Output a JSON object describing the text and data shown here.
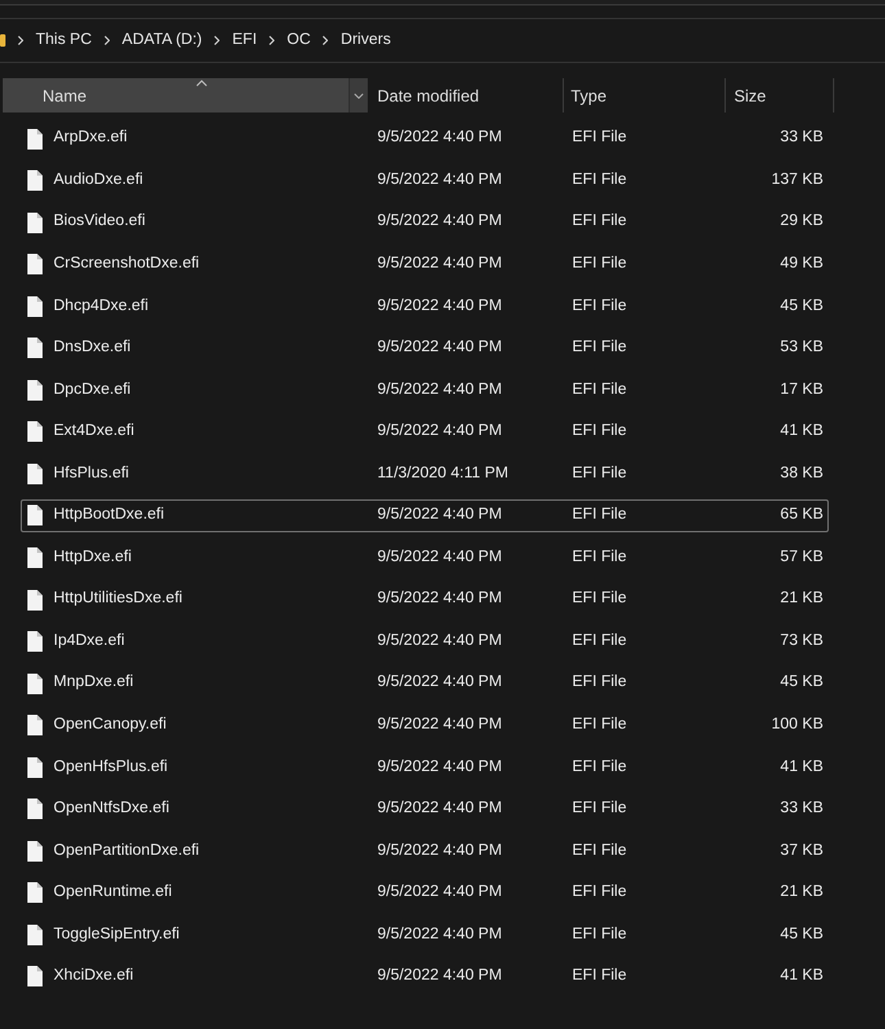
{
  "breadcrumbs": [
    "This PC",
    "ADATA (D:)",
    "EFI",
    "OC",
    "Drivers"
  ],
  "columns": [
    {
      "label": "Name",
      "sorted": true,
      "hovered": true
    },
    {
      "label": "Date modified",
      "sorted": false,
      "hovered": false
    },
    {
      "label": "Type",
      "sorted": false,
      "hovered": false
    },
    {
      "label": "Size",
      "sorted": false,
      "hovered": false
    }
  ],
  "files": [
    {
      "name": "ArpDxe.efi",
      "date_modified": "9/5/2022 4:40 PM",
      "type": "EFI File",
      "size": "33 KB",
      "focused": false
    },
    {
      "name": "AudioDxe.efi",
      "date_modified": "9/5/2022 4:40 PM",
      "type": "EFI File",
      "size": "137 KB",
      "focused": false
    },
    {
      "name": "BiosVideo.efi",
      "date_modified": "9/5/2022 4:40 PM",
      "type": "EFI File",
      "size": "29 KB",
      "focused": false
    },
    {
      "name": "CrScreenshotDxe.efi",
      "date_modified": "9/5/2022 4:40 PM",
      "type": "EFI File",
      "size": "49 KB",
      "focused": false
    },
    {
      "name": "Dhcp4Dxe.efi",
      "date_modified": "9/5/2022 4:40 PM",
      "type": "EFI File",
      "size": "45 KB",
      "focused": false
    },
    {
      "name": "DnsDxe.efi",
      "date_modified": "9/5/2022 4:40 PM",
      "type": "EFI File",
      "size": "53 KB",
      "focused": false
    },
    {
      "name": "DpcDxe.efi",
      "date_modified": "9/5/2022 4:40 PM",
      "type": "EFI File",
      "size": "17 KB",
      "focused": false
    },
    {
      "name": "Ext4Dxe.efi",
      "date_modified": "9/5/2022 4:40 PM",
      "type": "EFI File",
      "size": "41 KB",
      "focused": false
    },
    {
      "name": "HfsPlus.efi",
      "date_modified": "11/3/2020 4:11 PM",
      "type": "EFI File",
      "size": "38 KB",
      "focused": false
    },
    {
      "name": "HttpBootDxe.efi",
      "date_modified": "9/5/2022 4:40 PM",
      "type": "EFI File",
      "size": "65 KB",
      "focused": true
    },
    {
      "name": "HttpDxe.efi",
      "date_modified": "9/5/2022 4:40 PM",
      "type": "EFI File",
      "size": "57 KB",
      "focused": false
    },
    {
      "name": "HttpUtilitiesDxe.efi",
      "date_modified": "9/5/2022 4:40 PM",
      "type": "EFI File",
      "size": "21 KB",
      "focused": false
    },
    {
      "name": "Ip4Dxe.efi",
      "date_modified": "9/5/2022 4:40 PM",
      "type": "EFI File",
      "size": "73 KB",
      "focused": false
    },
    {
      "name": "MnpDxe.efi",
      "date_modified": "9/5/2022 4:40 PM",
      "type": "EFI File",
      "size": "45 KB",
      "focused": false
    },
    {
      "name": "OpenCanopy.efi",
      "date_modified": "9/5/2022 4:40 PM",
      "type": "EFI File",
      "size": "100 KB",
      "focused": false
    },
    {
      "name": "OpenHfsPlus.efi",
      "date_modified": "9/5/2022 4:40 PM",
      "type": "EFI File",
      "size": "41 KB",
      "focused": false
    },
    {
      "name": "OpenNtfsDxe.efi",
      "date_modified": "9/5/2022 4:40 PM",
      "type": "EFI File",
      "size": "33 KB",
      "focused": false
    },
    {
      "name": "OpenPartitionDxe.efi",
      "date_modified": "9/5/2022 4:40 PM",
      "type": "EFI File",
      "size": "37 KB",
      "focused": false
    },
    {
      "name": "OpenRuntime.efi",
      "date_modified": "9/5/2022 4:40 PM",
      "type": "EFI File",
      "size": "21 KB",
      "focused": false
    },
    {
      "name": "ToggleSipEntry.efi",
      "date_modified": "9/5/2022 4:40 PM",
      "type": "EFI File",
      "size": "45 KB",
      "focused": false
    },
    {
      "name": "XhciDxe.efi",
      "date_modified": "9/5/2022 4:40 PM",
      "type": "EFI File",
      "size": "41 KB",
      "focused": false
    }
  ]
}
